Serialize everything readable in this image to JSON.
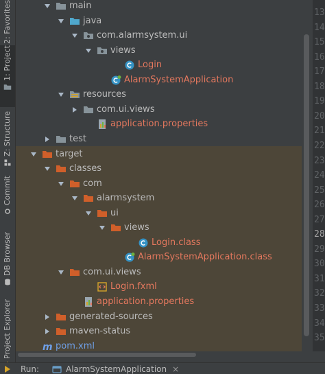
{
  "left_strip": {
    "tabs": [
      {
        "label": "2: Favorites",
        "icon": "star-icon"
      },
      {
        "label": "1: Project",
        "icon": "folder-icon",
        "active": true
      },
      {
        "label": "Z: Structure",
        "icon": "structure-icon"
      },
      {
        "label": "Commit",
        "icon": "commit-icon"
      },
      {
        "label": "DB Browser",
        "icon": "database-icon"
      },
      {
        "label": "Project Explorer",
        "icon": "project-explorer-icon"
      }
    ]
  },
  "tree": {
    "rows": [
      {
        "label": "main",
        "depth": 2,
        "arrow": "expanded",
        "icon": "folder-icon",
        "style": "normal"
      },
      {
        "label": "java",
        "depth": 3,
        "arrow": "expanded",
        "icon": "source-folder-icon",
        "style": "normal"
      },
      {
        "label": "com.alarmsystem.ui",
        "depth": 4,
        "arrow": "expanded",
        "icon": "package-icon",
        "style": "normal"
      },
      {
        "label": "views",
        "depth": 5,
        "arrow": "expanded",
        "icon": "package-icon",
        "style": "normal"
      },
      {
        "label": "Login",
        "depth": 7,
        "arrow": "none",
        "icon": "java-class-icon",
        "style": "orange"
      },
      {
        "label": "AlarmSystemApplication",
        "depth": 6,
        "arrow": "none",
        "icon": "spring-boot-class-icon",
        "style": "orange"
      },
      {
        "label": "resources",
        "depth": 3,
        "arrow": "expanded",
        "icon": "resources-folder-icon",
        "style": "normal"
      },
      {
        "label": "com.ui.views",
        "depth": 4,
        "arrow": "collapsed",
        "icon": "folder-icon",
        "style": "normal"
      },
      {
        "label": "application.properties",
        "depth": 5,
        "arrow": "none",
        "icon": "properties-file-icon",
        "style": "orange"
      },
      {
        "label": "test",
        "depth": 2,
        "arrow": "collapsed",
        "icon": "folder-icon",
        "style": "normal"
      },
      {
        "label": "target",
        "depth": 1,
        "arrow": "expanded",
        "icon": "excluded-folder-icon",
        "style": "normal"
      },
      {
        "label": "classes",
        "depth": 2,
        "arrow": "expanded",
        "icon": "excluded-folder-icon",
        "style": "normal"
      },
      {
        "label": "com",
        "depth": 3,
        "arrow": "expanded",
        "icon": "excluded-folder-icon",
        "style": "normal"
      },
      {
        "label": "alarmsystem",
        "depth": 4,
        "arrow": "expanded",
        "icon": "excluded-folder-icon",
        "style": "normal"
      },
      {
        "label": "ui",
        "depth": 5,
        "arrow": "expanded",
        "icon": "excluded-folder-icon",
        "style": "normal"
      },
      {
        "label": "views",
        "depth": 6,
        "arrow": "expanded",
        "icon": "excluded-folder-icon",
        "style": "normal"
      },
      {
        "label": "Login.class",
        "depth": 8,
        "arrow": "none",
        "icon": "java-class-icon",
        "style": "orange"
      },
      {
        "label": "AlarmSystemApplication.class",
        "depth": 7,
        "arrow": "none",
        "icon": "spring-boot-class-icon",
        "style": "orange"
      },
      {
        "label": "com.ui.views",
        "depth": 3,
        "arrow": "expanded",
        "icon": "excluded-folder-icon",
        "style": "normal"
      },
      {
        "label": "Login.fxml",
        "depth": 5,
        "arrow": "none",
        "icon": "fxml-file-icon",
        "style": "orange"
      },
      {
        "label": "application.properties",
        "depth": 4,
        "arrow": "none",
        "icon": "properties-file-icon",
        "style": "orange"
      },
      {
        "label": "generated-sources",
        "depth": 2,
        "arrow": "collapsed",
        "icon": "excluded-folder-icon",
        "style": "normal"
      },
      {
        "label": "maven-status",
        "depth": 2,
        "arrow": "collapsed",
        "icon": "excluded-folder-icon",
        "style": "normal"
      },
      {
        "label": "pom.xml",
        "depth": 1,
        "arrow": "none",
        "icon": "maven-file-icon",
        "style": "mod"
      }
    ]
  },
  "gutter": {
    "line_numbers": [
      "13",
      "14",
      "15",
      "16",
      "17",
      "18",
      "19",
      "20",
      "21",
      "22",
      "23",
      "24",
      "25",
      "26",
      "27",
      "28",
      "29",
      "30",
      "31",
      "32",
      "33",
      "34",
      "35"
    ],
    "current_line": "28"
  },
  "run_bar": {
    "label": "Run:",
    "tab_label": "AlarmSystemApplication",
    "close_glyph": "×"
  },
  "colors": {
    "panel_bg": "#3c3f41",
    "excluded_bg": "#4d4638",
    "text": "#bbbbbb",
    "error_text": "#e4785e",
    "folder_blue": "#4fa7cc",
    "excluded_folder": "#d05f2a"
  }
}
